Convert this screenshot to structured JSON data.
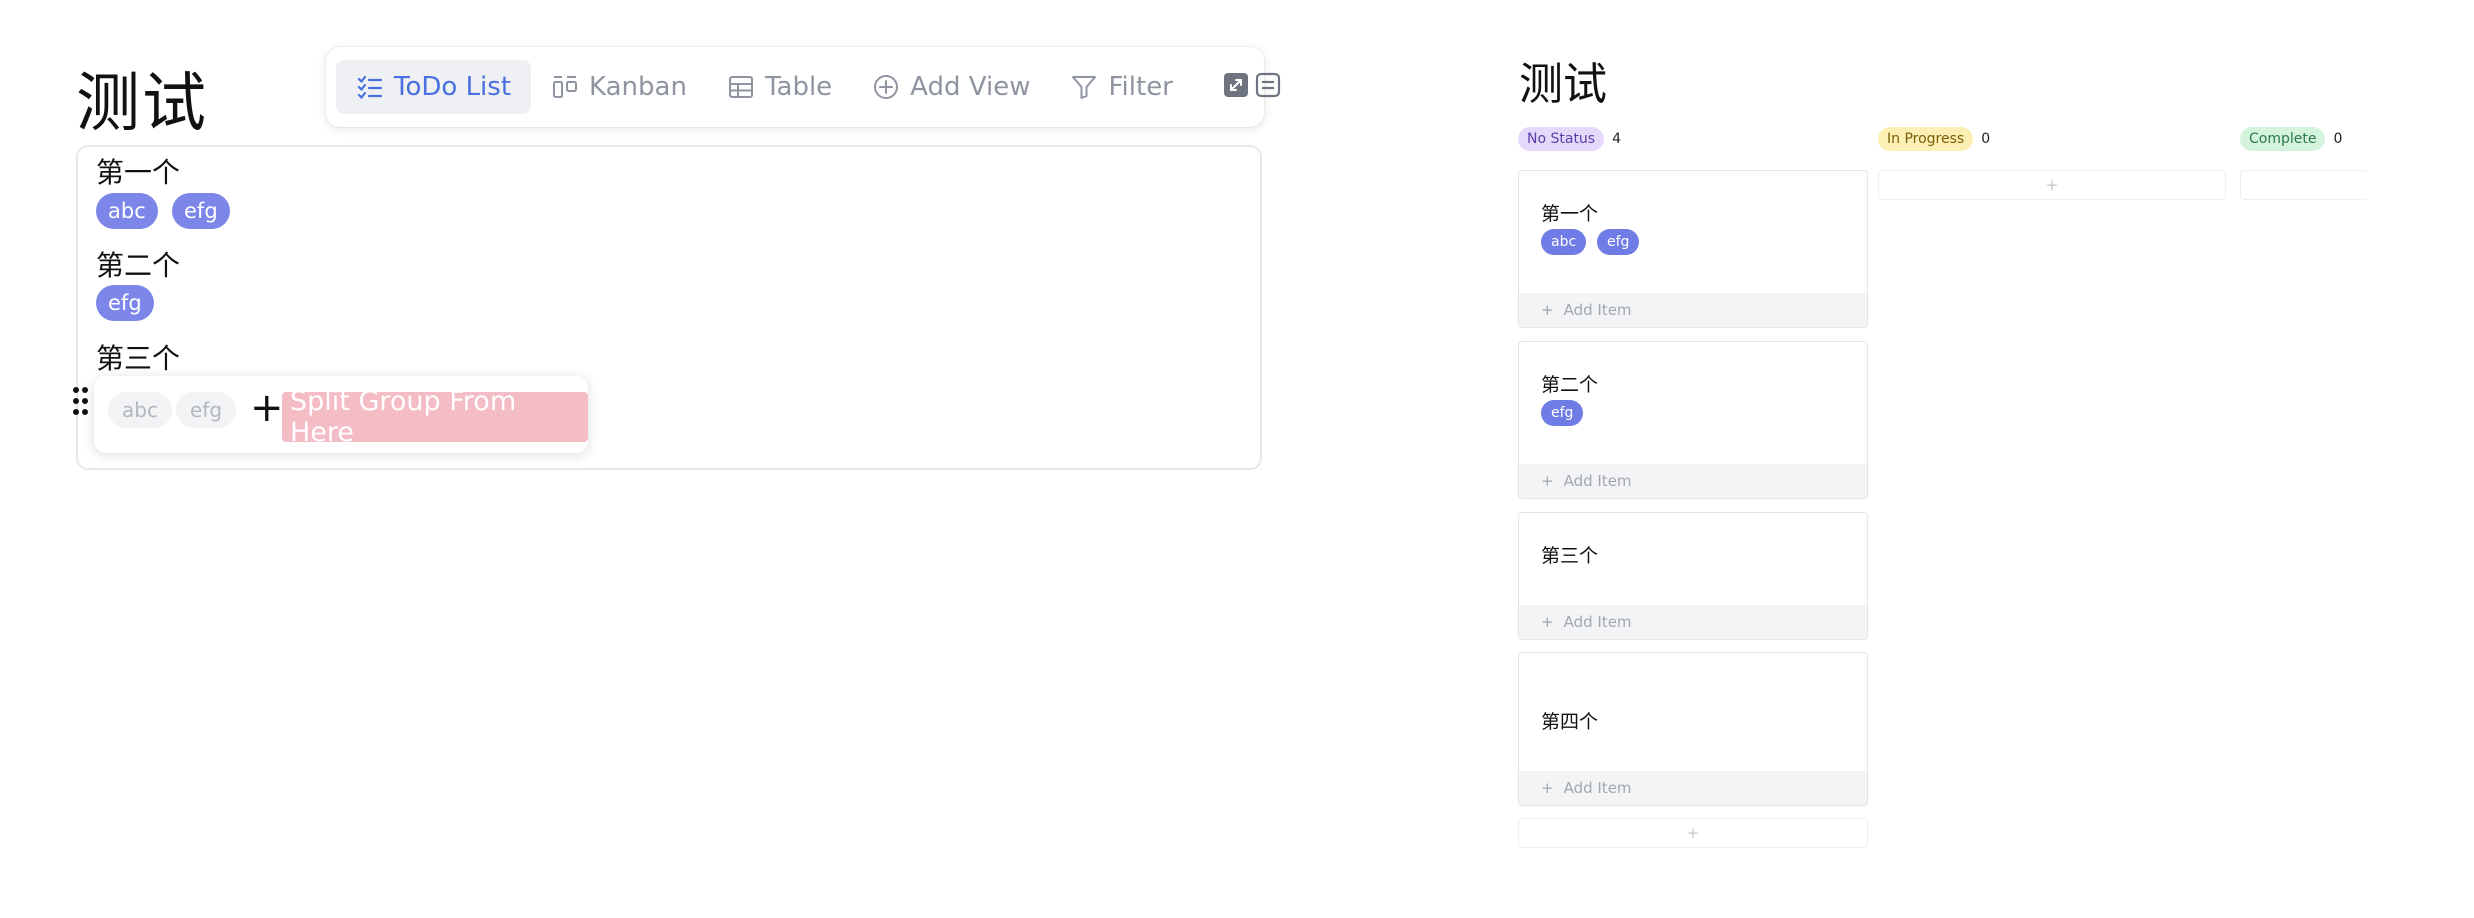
{
  "left": {
    "title": "测试",
    "toolbar": {
      "items": [
        {
          "label": "ToDo List",
          "icon": "list-check-icon",
          "active": true
        },
        {
          "label": "Kanban",
          "icon": "kanban-icon",
          "active": false
        },
        {
          "label": "Table",
          "icon": "table-icon",
          "active": false
        },
        {
          "label": "Add View",
          "icon": "add-circle-icon",
          "active": false
        },
        {
          "label": "Filter",
          "icon": "filter-icon",
          "active": false
        }
      ],
      "buttons": [
        "expand-icon",
        "layout-icon"
      ]
    },
    "list": {
      "items": [
        {
          "title": "第一个",
          "tags": [
            "abc",
            "efg"
          ]
        },
        {
          "title": "第二个",
          "tags": [
            "efg"
          ]
        },
        {
          "title": "第三个",
          "tags": []
        }
      ]
    },
    "popup": {
      "tags": [
        "abc",
        "efg"
      ],
      "plus": "+",
      "split_label": "Split Group From Here"
    }
  },
  "right": {
    "title": "测试",
    "columns": [
      {
        "label": "No Status",
        "count": "4",
        "badge_bg": "#e4d9fb",
        "badge_fg": "#5b3fa8"
      },
      {
        "label": "In Progress",
        "count": "0",
        "badge_bg": "#fbefb3",
        "badge_fg": "#7a5d08"
      },
      {
        "label": "Complete",
        "count": "0",
        "badge_bg": "#d3f3dc",
        "badge_fg": "#2b7a45"
      }
    ],
    "cards": [
      {
        "title": "第一个",
        "tags": [
          "abc",
          "efg"
        ],
        "add_label": "Add Item"
      },
      {
        "title": "第二个",
        "tags": [
          "efg"
        ],
        "add_label": "Add Item"
      },
      {
        "title": "第三个",
        "tags": [],
        "add_label": "Add Item"
      },
      {
        "title": "第四个",
        "tags": [],
        "add_label": "Add Item"
      }
    ],
    "plus": "+"
  },
  "colors": {
    "accent": "#4a6fe0",
    "tag": "#7b86e8",
    "split": "#f4bcc4"
  }
}
